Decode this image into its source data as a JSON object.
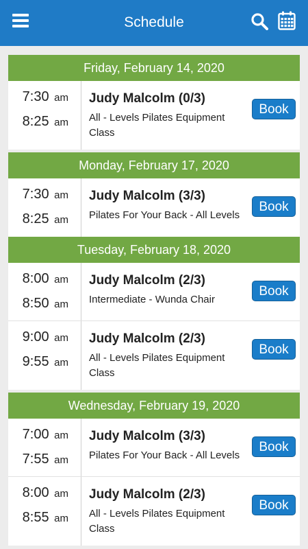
{
  "header": {
    "title": "Schedule",
    "menu_icon": "hamburger-menu-icon",
    "search_icon": "search-icon",
    "calendar_icon": "calendar-icon"
  },
  "days": [
    {
      "date": "Friday, February 14, 2020",
      "classes": [
        {
          "start": "7:30",
          "start_ampm": "am",
          "end": "8:25",
          "end_ampm": "am",
          "instructor": "Judy Malcolm (0/3)",
          "class_name": "All - Levels Pilates Equipment Class",
          "book": "Book"
        }
      ]
    },
    {
      "date": "Monday, February 17, 2020",
      "classes": [
        {
          "start": "7:30",
          "start_ampm": "am",
          "end": "8:25",
          "end_ampm": "am",
          "instructor": "Judy Malcolm (3/3)",
          "class_name": "Pilates For Your Back - All Levels",
          "book": "Book"
        }
      ]
    },
    {
      "date": "Tuesday, February 18, 2020",
      "classes": [
        {
          "start": "8:00",
          "start_ampm": "am",
          "end": "8:50",
          "end_ampm": "am",
          "instructor": "Judy Malcolm (2/3)",
          "class_name": "Intermediate - Wunda Chair",
          "book": "Book"
        },
        {
          "start": "9:00",
          "start_ampm": "am",
          "end": "9:55",
          "end_ampm": "am",
          "instructor": "Judy Malcolm (2/3)",
          "class_name": "All - Levels Pilates Equipment Class",
          "book": "Book"
        }
      ]
    },
    {
      "date": "Wednesday, February 19, 2020",
      "classes": [
        {
          "start": "7:00",
          "start_ampm": "am",
          "end": "7:55",
          "end_ampm": "am",
          "instructor": "Judy Malcolm (3/3)",
          "class_name": "Pilates For Your Back - All Levels",
          "book": "Book"
        },
        {
          "start": "8:00",
          "start_ampm": "am",
          "end": "8:55",
          "end_ampm": "am",
          "instructor": "Judy Malcolm (2/3)",
          "class_name": "All - Levels Pilates Equipment Class",
          "book": "Book"
        }
      ]
    }
  ]
}
